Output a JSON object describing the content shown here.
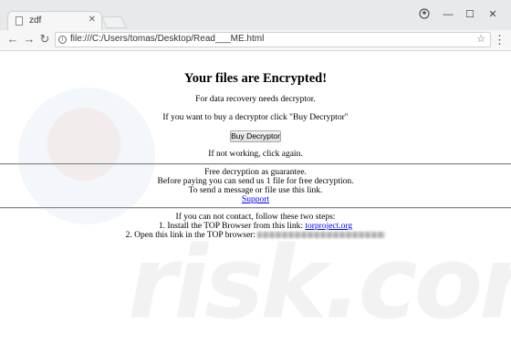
{
  "browser": {
    "tab_title": "zdf",
    "address": "file:///C:/Users/tomas/Desktop/Read___ME.html"
  },
  "page": {
    "heading": "Your files are Encrypted!",
    "line1": "For data recovery needs decryptor.",
    "line2": "If you want to buy a decryptor click \"Buy Decryptor\"",
    "buy_button": "Buy Decryptor",
    "line3": "If not working, click again.",
    "free1": "Free decryption as guarantee.",
    "free2": "Before paying you can send us 1 file for free decryption.",
    "free3": "To send a message or file use this link.",
    "support_link": "Support",
    "steps_intro": "If you can not contact, follow these two steps:",
    "step1_text": "1. Install the TOP Browser from this link:",
    "step1_link": "torproject.org",
    "step2_text": "2. Open this link in the TOP browser:"
  },
  "colors": {
    "link": "#0000ee",
    "chrome_bg": "#e7e9eb"
  },
  "icons": [
    "doc-icon",
    "close-icon",
    "back-icon",
    "forward-icon",
    "reload-icon",
    "info-icon",
    "star-icon",
    "menu-icon",
    "profile-icon",
    "minimize-icon",
    "maximize-icon",
    "window-close-icon"
  ]
}
